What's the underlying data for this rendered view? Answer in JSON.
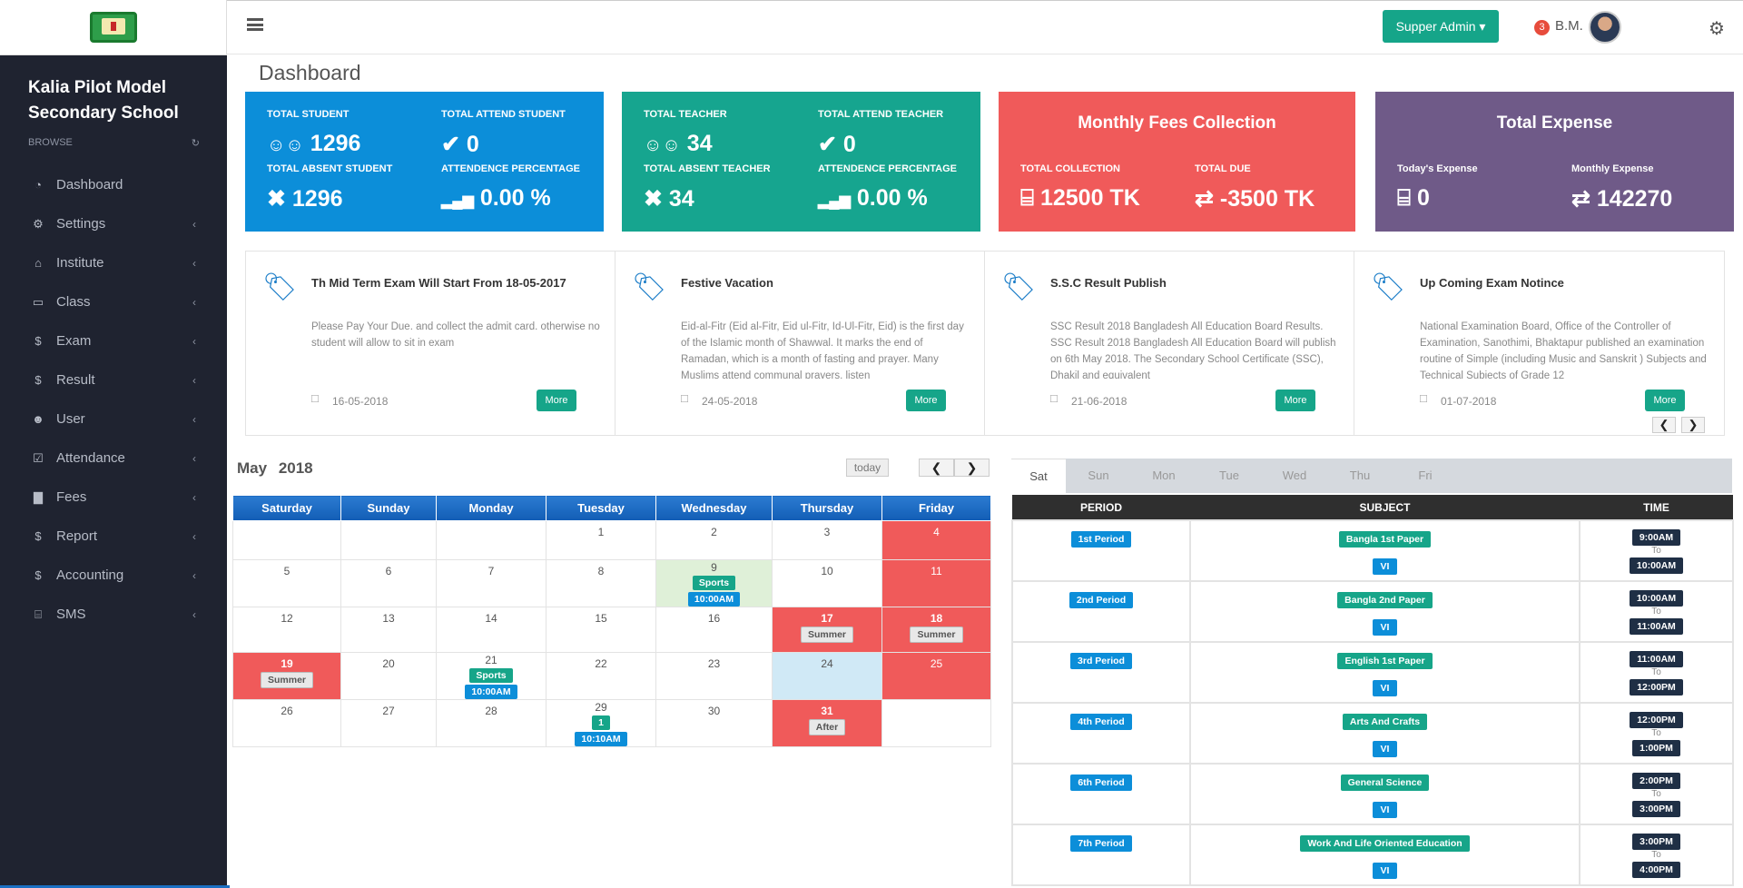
{
  "sidebar": {
    "school_name": "Kalia Pilot Model\nSecondary School",
    "browse_label": "BROWSE",
    "items": [
      {
        "label": "Dashboard",
        "icon": "dashboard-icon"
      },
      {
        "label": "Settings",
        "icon": "cogs-icon"
      },
      {
        "label": "Institute",
        "icon": "institution-icon"
      },
      {
        "label": "Class",
        "icon": "laptop-icon"
      },
      {
        "label": "Exam",
        "icon": "dollar-icon"
      },
      {
        "label": "Result",
        "icon": "dollar-icon"
      },
      {
        "label": "User",
        "icon": "user-icon"
      },
      {
        "label": "Attendance",
        "icon": "check-square-icon"
      },
      {
        "label": "Fees",
        "icon": "area-chart-icon"
      },
      {
        "label": "Report",
        "icon": "dollar-icon"
      },
      {
        "label": "Accounting",
        "icon": "dollar-icon"
      },
      {
        "label": "SMS",
        "icon": "money-icon"
      }
    ]
  },
  "header": {
    "admin_button": "Supper Admin",
    "notification_count": "3",
    "user_name": "B.M."
  },
  "page": {
    "title": "Dashboard"
  },
  "stats": {
    "student": {
      "total_label": "TOTAL STUDENT",
      "total": "1296",
      "attend_label": "TOTAL ATTEND STUDENT",
      "attend": "0",
      "absent_label": "TOTAL ABSENT STUDENT",
      "absent": "1296",
      "pct_label": "ATTENDENCE PERCENTAGE",
      "pct": "0.00 %"
    },
    "teacher": {
      "total_label": "TOTAL TEACHER",
      "total": "34",
      "attend_label": "TOTAL ATTEND TEACHER",
      "attend": "0",
      "absent_label": "TOTAL ABSENT TEACHER",
      "absent": "34",
      "pct_label": "ATTENDENCE PERCENTAGE",
      "pct": "0.00 %"
    },
    "fees": {
      "title": "Monthly Fees Collection",
      "collection_label": "TOTAL COLLECTION",
      "collection": "12500 TK",
      "due_label": "TOTAL DUE",
      "due": "-3500 TK"
    },
    "expense": {
      "title": "Total Expense",
      "today_label": "Today's Expense",
      "today": "0",
      "monthly_label": "Monthly Expense",
      "monthly": "142270"
    }
  },
  "notices": [
    {
      "title": "Th Mid Term Exam Will Start From 18-05-2017",
      "body": "Please Pay Your Due. and collect the admit card. otherwise no student will allow to sit in exam",
      "date": "16-05-2018",
      "more": "More"
    },
    {
      "title": "Festive Vacation",
      "body": "Eid-al-Fitr (Eid al-Fitr, Eid ul-Fitr, Id-Ul-Fitr, Eid) is the first day of the Islamic month of Shawwal. It marks the end of Ramadan, which is a month of fasting and prayer. Many Muslims attend communal prayers, listen",
      "date": "24-05-2018",
      "more": "More"
    },
    {
      "title": "S.S.C Result Publish",
      "body": "SSC Result 2018 Bangladesh All Education Board Results. SSC Result 2018 Bangladesh All Education Board will publish on 6th May 2018. The Secondary School Certificate (SSC), Dhakil and equivalent",
      "date": "21-06-2018",
      "more": "More"
    },
    {
      "title": "Up Coming Exam Notince",
      "body": "National Examination Board, Office of the Controller of Examination, Sanothimi, Bhaktapur published an examination routine of Simple (including Music and Sanskrit ) Subjects and Technical Subjects of Grade 12",
      "date": "01-07-2018",
      "more": "More"
    }
  ],
  "calendar": {
    "month": "May",
    "year": "2018",
    "today_label": "today",
    "days": [
      "Saturday",
      "Sunday",
      "Monday",
      "Tuesday",
      "Wednesday",
      "Thursday",
      "Friday"
    ],
    "weeks": [
      [
        {
          "d": ""
        },
        {
          "d": ""
        },
        {
          "d": ""
        },
        {
          "d": "1"
        },
        {
          "d": "2"
        },
        {
          "d": "3"
        },
        {
          "d": "4",
          "bg": "red"
        }
      ],
      [
        {
          "d": "5"
        },
        {
          "d": "6"
        },
        {
          "d": "7"
        },
        {
          "d": "8"
        },
        {
          "d": "9",
          "bg": "green",
          "events": [
            {
              "t": "Sports",
              "c": "teal"
            },
            {
              "t": "10:00AM",
              "c": "blue"
            }
          ]
        },
        {
          "d": "10"
        },
        {
          "d": "11",
          "bg": "red"
        }
      ],
      [
        {
          "d": "12"
        },
        {
          "d": "13"
        },
        {
          "d": "14"
        },
        {
          "d": "15"
        },
        {
          "d": "16"
        },
        {
          "d": "17",
          "bg": "red",
          "events": [
            {
              "t": "Summer",
              "c": "gray"
            }
          ]
        },
        {
          "d": "18",
          "bg": "red",
          "events": [
            {
              "t": "Summer",
              "c": "gray"
            }
          ]
        }
      ],
      [
        {
          "d": "19",
          "bg": "red",
          "events": [
            {
              "t": "Summer",
              "c": "gray"
            }
          ]
        },
        {
          "d": "20"
        },
        {
          "d": "21",
          "events": [
            {
              "t": "Sports",
              "c": "teal"
            },
            {
              "t": "10:00AM",
              "c": "blue"
            }
          ]
        },
        {
          "d": "22"
        },
        {
          "d": "23"
        },
        {
          "d": "24",
          "bg": "blue"
        },
        {
          "d": "25",
          "bg": "red"
        }
      ],
      [
        {
          "d": "26"
        },
        {
          "d": "27"
        },
        {
          "d": "28"
        },
        {
          "d": "29",
          "events": [
            {
              "t": "1",
              "c": "teal"
            },
            {
              "t": "10:10AM",
              "c": "blue"
            }
          ]
        },
        {
          "d": "30"
        },
        {
          "d": "31",
          "bg": "red",
          "events": [
            {
              "t": "After",
              "c": "gray"
            }
          ]
        },
        {
          "d": ""
        }
      ]
    ]
  },
  "routine": {
    "tabs": [
      "Sat",
      "Sun",
      "Mon",
      "Tue",
      "Wed",
      "Thu",
      "Fri"
    ],
    "active_tab": "Sat",
    "headers": [
      "PERIOD",
      "SUBJECT",
      "TIME"
    ],
    "to_label": "To",
    "rows": [
      {
        "period": "1st Period",
        "subject": "Bangla 1st Paper",
        "class": "VI",
        "start": "9:00AM",
        "end": "10:00AM"
      },
      {
        "period": "2nd Period",
        "subject": "Bangla 2nd Paper",
        "class": "VI",
        "start": "10:00AM",
        "end": "11:00AM"
      },
      {
        "period": "3rd Period",
        "subject": "English 1st Paper",
        "class": "VI",
        "start": "11:00AM",
        "end": "12:00PM"
      },
      {
        "period": "4th Period",
        "subject": "Arts And Crafts",
        "class": "VI",
        "start": "12:00PM",
        "end": "1:00PM"
      },
      {
        "period": "6th Period",
        "subject": "General Science",
        "class": "VI",
        "start": "2:00PM",
        "end": "3:00PM"
      },
      {
        "period": "7th Period",
        "subject": "Work And Life Oriented Education",
        "class": "VI",
        "start": "3:00PM",
        "end": "4:00PM"
      }
    ]
  }
}
